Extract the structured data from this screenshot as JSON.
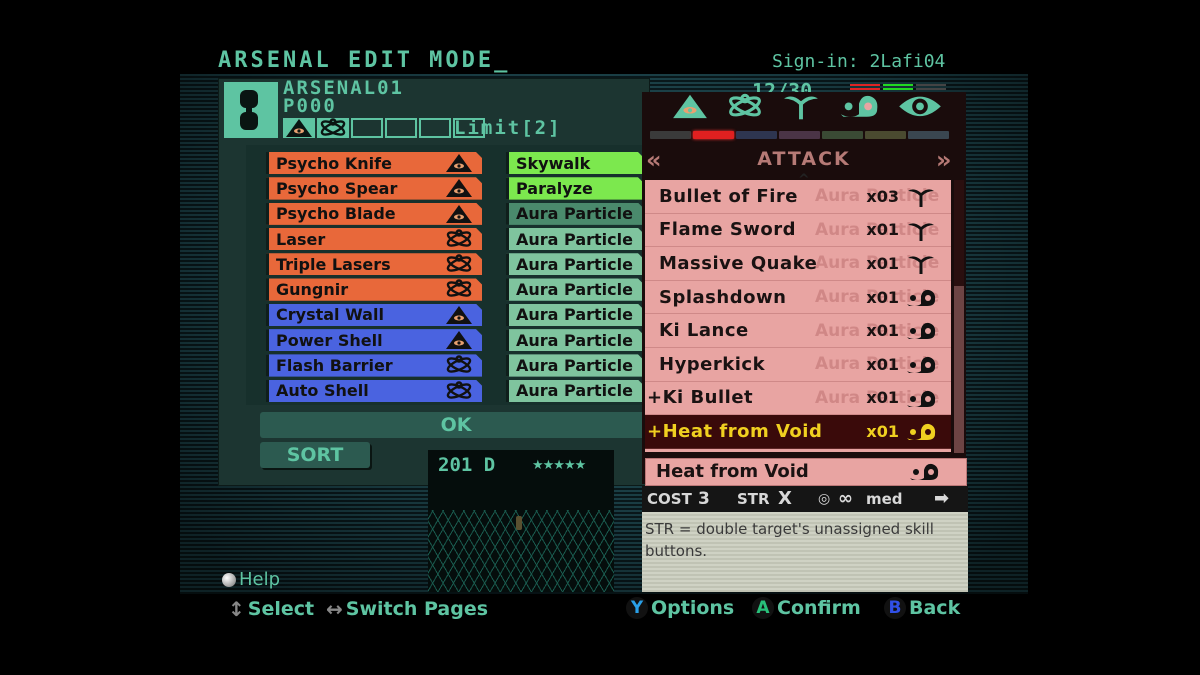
{
  "header": {
    "title": "ARSENAL EDIT MODE_",
    "sign_in": "Sign-in: 2Lafi04",
    "counter": "12/30"
  },
  "arsenal": {
    "name": "ARSENAL01",
    "code": "P000",
    "limit": "Limit[2]",
    "school_slots": [
      "psycho-icon",
      "optical-icon",
      "",
      "",
      "",
      ""
    ],
    "meters": [
      {
        "color": "#e02424"
      },
      {
        "color": "#22d822"
      },
      {
        "color": "#444444"
      }
    ]
  },
  "deck_left": [
    {
      "name": "Psycho Knife",
      "color": "orange",
      "icon": "psycho-icon"
    },
    {
      "name": "Psycho Spear",
      "color": "orange",
      "icon": "psycho-icon"
    },
    {
      "name": "Psycho Blade",
      "color": "orange",
      "icon": "psycho-icon"
    },
    {
      "name": "Laser",
      "color": "orange",
      "icon": "optical-icon"
    },
    {
      "name": "Triple Lasers",
      "color": "orange",
      "icon": "optical-icon"
    },
    {
      "name": "Gungnir",
      "color": "orange",
      "icon": "optical-icon"
    },
    {
      "name": "Crystal Wall",
      "color": "blue",
      "icon": "psycho-icon"
    },
    {
      "name": "Power Shell",
      "color": "blue",
      "icon": "psycho-icon"
    },
    {
      "name": "Flash Barrier",
      "color": "blue",
      "icon": "optical-icon"
    },
    {
      "name": "Auto Shell",
      "color": "blue",
      "icon": "optical-icon"
    }
  ],
  "deck_right": [
    {
      "name": "Skywalk",
      "color": "green"
    },
    {
      "name": "Paralyze",
      "color": "green"
    },
    {
      "name": "Aura Particle",
      "color": "teal",
      "selected": true
    },
    {
      "name": "Aura Particle",
      "color": "teal"
    },
    {
      "name": "Aura Particle",
      "color": "teal"
    },
    {
      "name": "Aura Particle",
      "color": "teal"
    },
    {
      "name": "Aura Particle",
      "color": "teal"
    },
    {
      "name": "Aura Particle",
      "color": "teal"
    },
    {
      "name": "Aura Particle",
      "color": "teal"
    },
    {
      "name": "Aura Particle",
      "color": "teal"
    }
  ],
  "buttons": {
    "ok": "OK",
    "sort": "SORT"
  },
  "preview": {
    "label": "201 D",
    "stars": "★★★★★"
  },
  "skill_panel": {
    "category_icons": [
      "psycho-icon",
      "optical-icon",
      "nature-icon",
      "ki-icon",
      "faith-icon"
    ],
    "category_colors": [
      "#3a3a3a",
      "#e02020",
      "#2e3550",
      "#4a3446",
      "#3a4a34",
      "#4a4a30",
      "#3a4650"
    ],
    "active_category_index": 1,
    "category_title": "ATTACK",
    "prev_label": "«",
    "next_label": "»",
    "ghost_text": "Aura Particle",
    "skills": [
      {
        "name": "Bullet of Fire",
        "qty": "x03",
        "icon": "nature-icon",
        "plus": false
      },
      {
        "name": "Flame Sword",
        "qty": "x01",
        "icon": "nature-icon",
        "plus": false
      },
      {
        "name": "Massive Quake",
        "qty": "x01",
        "icon": "nature-icon",
        "plus": false
      },
      {
        "name": "Splashdown",
        "qty": "x01",
        "icon": "ki-icon",
        "plus": false
      },
      {
        "name": "Ki Lance",
        "qty": "x01",
        "icon": "ki-icon",
        "plus": false
      },
      {
        "name": "Hyperkick",
        "qty": "x01",
        "icon": "ki-icon",
        "plus": false
      },
      {
        "name": "+Ki Bullet",
        "qty": "x01",
        "icon": "ki-icon",
        "plus": true
      },
      {
        "name": "+Heat from Void",
        "qty": "x01",
        "icon": "ki-icon",
        "plus": true,
        "selected": true
      }
    ],
    "selected_name": "Heat from Void",
    "selected_icon": "ki-icon",
    "scroll_position": 0.39,
    "stats": {
      "cost_label": "COST",
      "cost_value": "3",
      "str_label": "STR",
      "str_value": "X",
      "range": "∞",
      "speed": "med"
    },
    "description": "STR = double target's unassigned skill buttons."
  },
  "footer": {
    "help": "Help",
    "select": "Select",
    "switch_pages": "Switch Pages",
    "options_btn": "Y",
    "options": "Options",
    "confirm_btn": "A",
    "confirm": "Confirm",
    "back_btn": "B",
    "back": "Back"
  },
  "colors": {
    "accent": "#5ec4a2",
    "orange": "#e8683a",
    "blue": "#4a63e0",
    "green": "#7ce84e",
    "teal": "#7fc49e",
    "skill_bg": "#e8a4a2",
    "selected_text": "#f0d020"
  }
}
